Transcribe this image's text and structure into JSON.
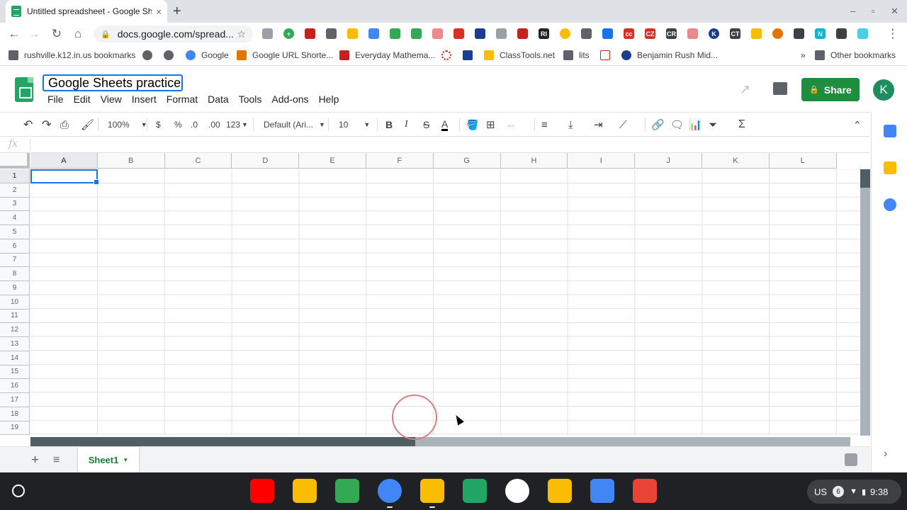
{
  "browser": {
    "tab_title": "Untitled spreadsheet - Google Sh",
    "tab_close": "×",
    "new_tab": "+",
    "window_controls": [
      "–",
      "▫",
      "✕"
    ],
    "url": "docs.google.com/spread..."
  },
  "bookmarks": [
    {
      "label": "rushville.k12.in.us bookmarks",
      "icon": "folder-icon"
    },
    {
      "label": "",
      "icon": "globe-icon"
    },
    {
      "label": "",
      "icon": "globe-icon"
    },
    {
      "label": "Google",
      "icon": "google-icon"
    },
    {
      "label": "Google URL Shorte...",
      "icon": "link-icon"
    },
    {
      "label": "Everyday Mathema...",
      "icon": "book-icon"
    },
    {
      "label": "",
      "icon": "circle-icon"
    },
    {
      "label": "",
      "icon": "house-icon"
    },
    {
      "label": "ClassTools.net",
      "icon": "classtools-icon"
    },
    {
      "label": "lits",
      "icon": "folder-icon"
    },
    {
      "label": "",
      "icon": "chart-icon"
    },
    {
      "label": "Benjamin Rush Mid...",
      "icon": "m-icon"
    }
  ],
  "bookmarks_more": "»",
  "other_bookmarks": "Other bookmarks",
  "sheets": {
    "doc_name": "Google Sheets practice",
    "menus": [
      "File",
      "Edit",
      "View",
      "Insert",
      "Format",
      "Data",
      "Tools",
      "Add-ons",
      "Help"
    ],
    "share_label": "Share",
    "avatar_initial": "K",
    "accent": "#1e8e3e"
  },
  "toolbar": {
    "zoom": "100%",
    "currency": "$",
    "percent": "%",
    "dec_decrease": ".0",
    "dec_increase": ".00",
    "more_formats": "123",
    "font": "Default (Ari...",
    "font_size": "10",
    "bold": "B",
    "italic": "I",
    "strike": "S",
    "text_color": "A",
    "sum": "Σ"
  },
  "formula_bar": {
    "fx": "fx"
  },
  "grid": {
    "columns": [
      "A",
      "B",
      "C",
      "D",
      "E",
      "F",
      "G",
      "H",
      "I",
      "J",
      "K",
      "L"
    ],
    "rows": [
      "1",
      "2",
      "3",
      "4",
      "5",
      "6",
      "7",
      "8",
      "9",
      "10",
      "11",
      "12",
      "13",
      "14",
      "15",
      "16",
      "17",
      "18",
      "19"
    ],
    "selected_cell": "A1"
  },
  "sheet_tabs": {
    "active": "Sheet1",
    "add": "+",
    "all": "≡"
  },
  "tray": {
    "locale": "US",
    "notifications": "6",
    "time": "9:38"
  }
}
